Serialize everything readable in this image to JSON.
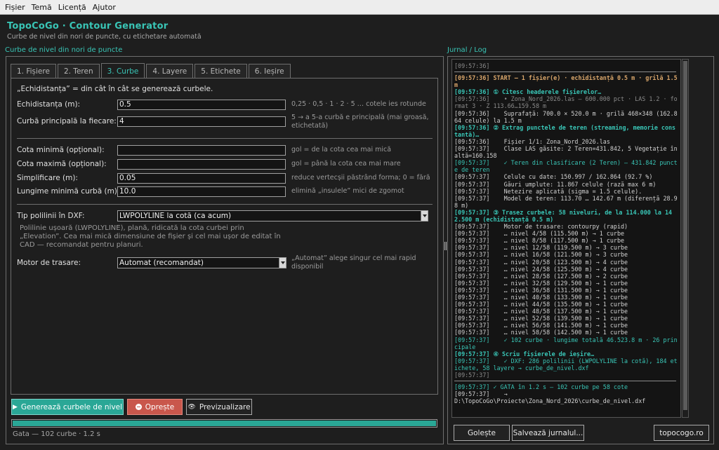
{
  "menu": [
    "Fișier",
    "Temă",
    "Licență",
    "Ajutor"
  ],
  "app": {
    "title": "TopoCoGo · Contour Generator",
    "subtitle": "Curbe de nivel din nori de puncte, cu etichetare automată"
  },
  "left_section_label": "Curbe de nivel din nori de puncte",
  "right_section_label": "Jurnal / Log",
  "tabs": [
    "1. Fișiere",
    "2. Teren",
    "3. Curbe",
    "4. Layere",
    "5. Etichete",
    "6. Ieșire"
  ],
  "active_tab": "3. Curbe",
  "info": "„Echidistanța” = din cât în cât se generează curbele.",
  "fields": {
    "echidistanta": {
      "label": "Echidistanța (m):",
      "value": "0.5",
      "hint": "0,25 · 0,5 · 1 · 2 · 5 …  cotele ies rotunde"
    },
    "principala": {
      "label": "Curbă principală la fiecare:",
      "value": "4",
      "hint": "5 → a 5-a curbă e principală (mai groasă, etichetată)"
    },
    "cota_min": {
      "label": "Cota minimă (opțional):",
      "value": "",
      "hint": "gol = de la cota cea mai mică"
    },
    "cota_max": {
      "label": "Cota maximă (opțional):",
      "value": "",
      "hint": "gol = până la cota cea mai mare"
    },
    "simplificare": {
      "label": "Simplificare (m):",
      "value": "0.05",
      "hint": "reduce vertecșii păstrând forma; 0 = fără"
    },
    "lungime_min": {
      "label": "Lungime minimă curbă (m):",
      "value": "10.0",
      "hint": "elimină „insulele” mici de zgomot"
    }
  },
  "dxf": {
    "label": "Tip polilinii în DXF:",
    "value": "LWPOLYLINE la cotă (ca acum)",
    "description": "Polilinie ușoară (LWPOLYLINE), plană, ridicată la cota curbei prin „Elevation”. Cea mai mică dimensiune de fișier și cel mai ușor de editat în CAD — recomandat pentru planuri."
  },
  "motor": {
    "label": "Motor de trasare:",
    "value": "Automat (recomandat)",
    "hint": "„Automat” alege singur cel mai rapid disponibil"
  },
  "buttons": {
    "generate": "Generează curbele de nivel",
    "stop": "Oprește",
    "preview": "Previzualizare",
    "clear": "Golește",
    "save_log": "Salvează jurnalul...",
    "site": "topocogo.ro"
  },
  "icons": {
    "generate": "play-icon",
    "stop": "stop-icon",
    "preview": "eye-icon"
  },
  "progress": {
    "fraction": 1.0
  },
  "status": "Gata — 102 curbe · 1.2 s",
  "log": [
    {
      "t": "[09:57:36]",
      "style": "muted"
    },
    {
      "t": "__sep__"
    },
    {
      "t": "[09:57:36] START — 1 fișier(e) · echidistanță 0.5 m · grilă 1.5 m",
      "style": "start"
    },
    {
      "t": "[09:57:36] ① Citesc headerele fișierelor…",
      "style": "accent"
    },
    {
      "t": "[09:57:36]    • Zona_Nord_2026.las — 600.000 pct · LAS 1.2 · format 3 · Z 113.66…159.58 m",
      "style": "muted"
    },
    {
      "t": "[09:57:36]    Suprafață: 700.0 × 520.0 m · grilă 468×348 (162.864 celule) la 1.5 m"
    },
    {
      "t": "[09:57:36] ② Extrag punctele de teren (streaming, memorie constantă)…",
      "style": "accent"
    },
    {
      "t": "[09:57:36]    Fișier 1/1: Zona_Nord_2026.las"
    },
    {
      "t": "[09:57:37]    Clase LAS găsite: 2 Teren=431.842, 5 Vegetație înaltă=160.158"
    },
    {
      "t": "[09:57:37]    ✓ Teren din clasificare (2 Teren) — 431.842 puncte de teren",
      "style": "ok"
    },
    {
      "t": "[09:57:37]    Celule cu date: 150.997 / 162.864 (92.7 %)"
    },
    {
      "t": "[09:57:37]    Găuri umplute: 11.867 celule (rază max 6 m)"
    },
    {
      "t": "[09:57:37]    Netezire aplicată (sigma = 1.5 celule)."
    },
    {
      "t": "[09:57:37]    Model de teren: 113.70 … 142.67 m (diferență 28.98 m)"
    },
    {
      "t": "[09:57:37] ③ Trasez curbele: 58 niveluri, de la 114.000 la 142.500 m (echidistanță 0.5 m)",
      "style": "accent"
    },
    {
      "t": "[09:57:37]    Motor de trasare: contourpy (rapid)"
    },
    {
      "t": "[09:57:37]    … nivel 4/58 (115.500 m) → 1 curbe"
    },
    {
      "t": "[09:57:37]    … nivel 8/58 (117.500 m) → 1 curbe"
    },
    {
      "t": "[09:57:37]    … nivel 12/58 (119.500 m) → 3 curbe"
    },
    {
      "t": "[09:57:37]    … nivel 16/58 (121.500 m) → 3 curbe"
    },
    {
      "t": "[09:57:37]    … nivel 20/58 (123.500 m) → 4 curbe"
    },
    {
      "t": "[09:57:37]    … nivel 24/58 (125.500 m) → 4 curbe"
    },
    {
      "t": "[09:57:37]    … nivel 28/58 (127.500 m) → 2 curbe"
    },
    {
      "t": "[09:57:37]    … nivel 32/58 (129.500 m) → 1 curbe"
    },
    {
      "t": "[09:57:37]    … nivel 36/58 (131.500 m) → 1 curbe"
    },
    {
      "t": "[09:57:37]    … nivel 40/58 (133.500 m) → 1 curbe"
    },
    {
      "t": "[09:57:37]    … nivel 44/58 (135.500 m) → 1 curbe"
    },
    {
      "t": "[09:57:37]    … nivel 48/58 (137.500 m) → 1 curbe"
    },
    {
      "t": "[09:57:37]    … nivel 52/58 (139.500 m) → 1 curbe"
    },
    {
      "t": "[09:57:37]    … nivel 56/58 (141.500 m) → 1 curbe"
    },
    {
      "t": "[09:57:37]    … nivel 58/58 (142.500 m) → 1 curbe"
    },
    {
      "t": "[09:57:37]    ✓ 102 curbe · lungime totală 46.523.8 m · 26 principale",
      "style": "ok"
    },
    {
      "t": "[09:57:37] ④ Scriu fișierele de ieșire…",
      "style": "accent"
    },
    {
      "t": "[09:57:37]    ✓ DXF: 286 polilinii (LWPOLYLINE la cotă), 184 etichete, 58 layere → curbe_de_nivel.dxf",
      "style": "ok"
    },
    {
      "t": "[09:57:37]",
      "style": "muted"
    },
    {
      "t": "__sep__"
    },
    {
      "t": "[09:57:37] ✓ GATA în 1.2 s — 102 curbe pe 58 cote",
      "style": "ok"
    },
    {
      "t": "[09:57:37]    →"
    },
    {
      "t": "D:\\TopoCoGo\\Proiecte\\Zona_Nord_2026\\curbe_de_nivel.dxf"
    }
  ]
}
